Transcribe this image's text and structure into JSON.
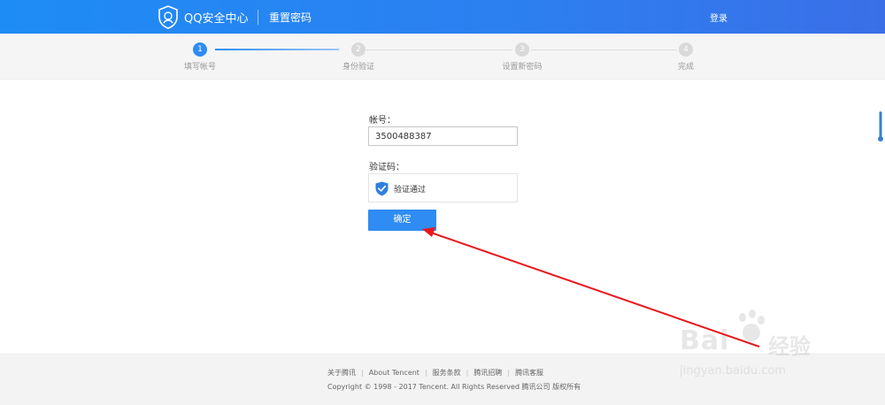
{
  "header": {
    "title": "QQ安全中心",
    "subtitle": "重置密码",
    "login": "登录",
    "bg_color": "#1e8cf5"
  },
  "steps": [
    {
      "number": "1",
      "label": "填写帐号",
      "active": true
    },
    {
      "number": "2",
      "label": "身份验证",
      "active": false
    },
    {
      "number": "3",
      "label": "设置新密码",
      "active": false
    },
    {
      "number": "4",
      "label": "完成",
      "active": false
    }
  ],
  "form": {
    "account_label": "帐号：",
    "account_value": "3500488387",
    "captcha_label": "验证码：",
    "captcha_status": "验证通过",
    "submit_label": "确定",
    "accent_color": "#2f8cf2"
  },
  "footer": {
    "links": [
      "关于腾讯",
      "About Tencent",
      "服务条款",
      "腾讯招聘",
      "腾讯客服"
    ],
    "copyright": "Copyright © 1998 - 2017 Tencent. All Rights Reserved 腾讯公司 版权所有"
  },
  "annotation": {
    "arrow_color": "#e8171c",
    "icon": "arrow-pointing-to-confirm-button"
  },
  "watermark": {
    "brand": "Bai",
    "cn": "经验",
    "url": "jingyan.baidu.com"
  }
}
